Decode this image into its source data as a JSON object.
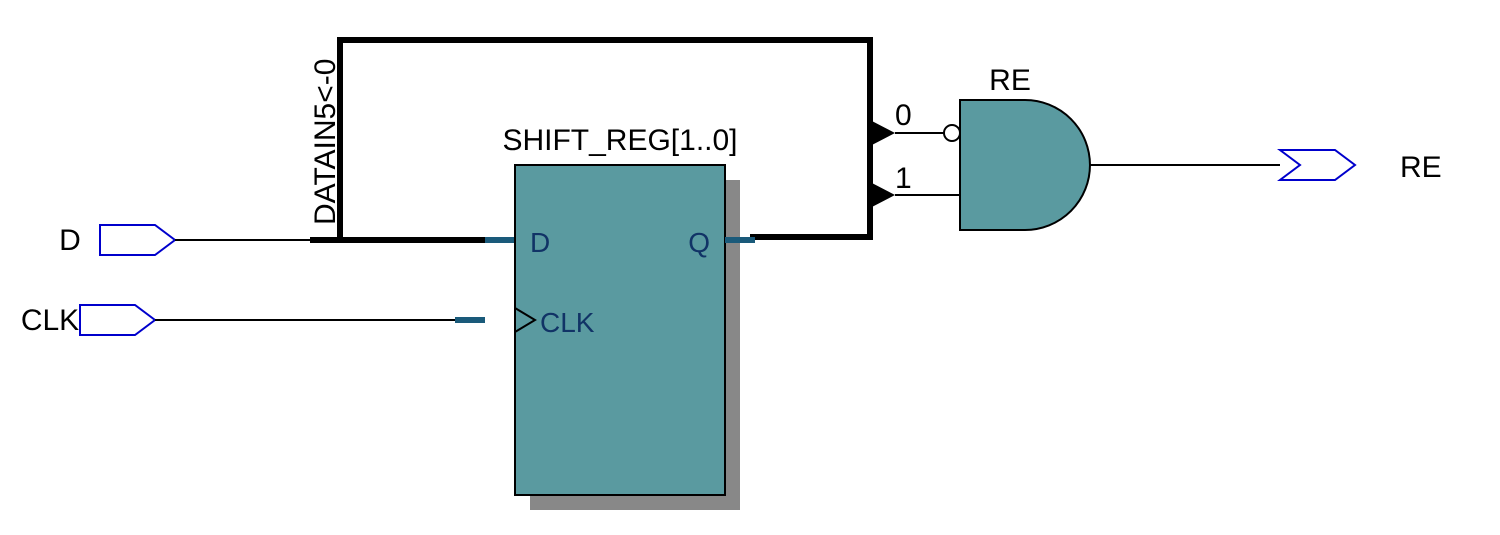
{
  "inputs": {
    "d_label": "D",
    "clk_label": "CLK"
  },
  "bus": {
    "feedback_label": "DATAIN5<-0"
  },
  "register": {
    "name": "SHIFT_REG[1..0]",
    "d_port": "D",
    "q_port": "Q",
    "clk_port": "CLK"
  },
  "gate": {
    "name": "RE",
    "input0": "0",
    "input1": "1"
  },
  "output": {
    "label": "RE"
  }
}
